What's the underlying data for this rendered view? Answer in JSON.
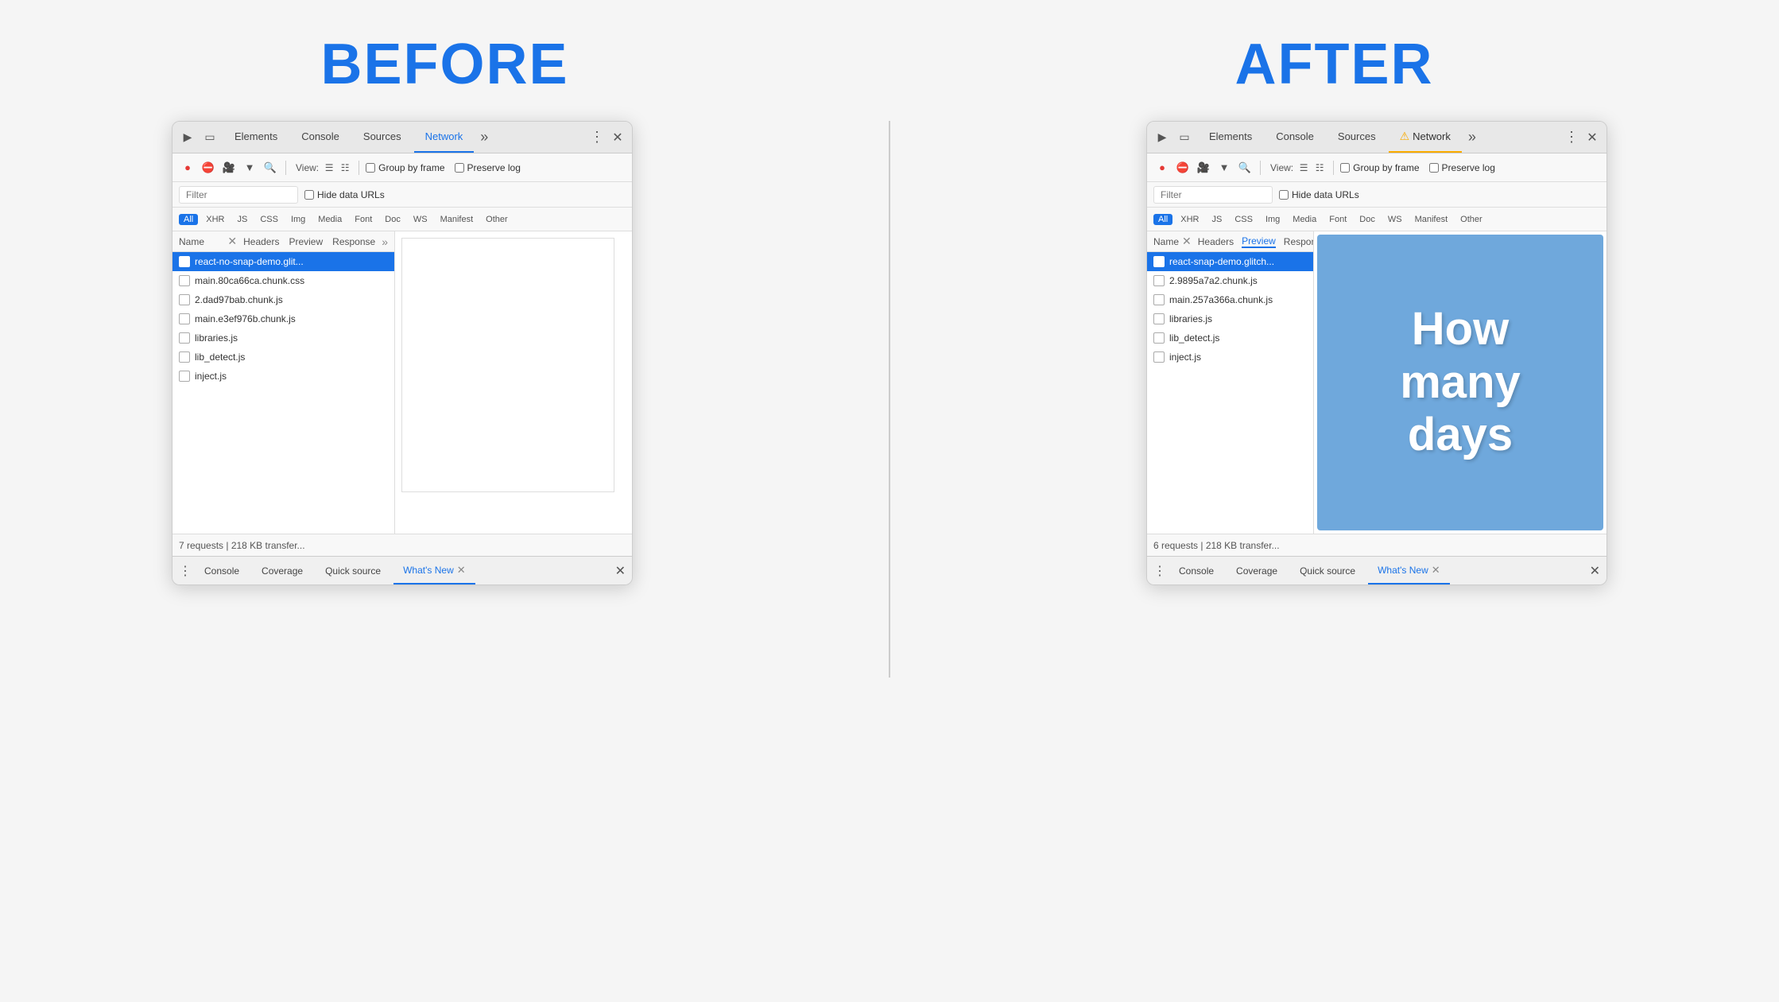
{
  "labels": {
    "before": "BEFORE",
    "after": "AFTER"
  },
  "before": {
    "tabs": [
      "Elements",
      "Console",
      "Sources",
      "Network"
    ],
    "active_tab": "Network",
    "toolbar": {
      "view_label": "View:",
      "group_by_frame": "Group by frame",
      "preserve_log": "Preserve log"
    },
    "filter": {
      "placeholder": "Filter",
      "hide_data_urls": "Hide data URLs"
    },
    "filter_types": [
      "All",
      "XHR",
      "JS",
      "CSS",
      "Img",
      "Media",
      "Font",
      "Doc",
      "WS",
      "Manifest",
      "Other"
    ],
    "active_filter": "All",
    "columns": [
      "Name"
    ],
    "detail_tabs": [
      "Headers",
      "Preview",
      "Response"
    ],
    "active_detail_tab": "Preview",
    "files": [
      {
        "name": "react-no-snap-demo.glit...",
        "selected": true
      },
      {
        "name": "main.80ca66ca.chunk.css",
        "selected": false
      },
      {
        "name": "2.dad97bab.chunk.js",
        "selected": false
      },
      {
        "name": "main.e3ef976b.chunk.js",
        "selected": false
      },
      {
        "name": "libraries.js",
        "selected": false
      },
      {
        "name": "lib_detect.js",
        "selected": false
      },
      {
        "name": "inject.js",
        "selected": false
      }
    ],
    "status": "7 requests | 218 KB transfer...",
    "drawer_tabs": [
      "Console",
      "Coverage",
      "Quick source",
      "What's New"
    ],
    "active_drawer_tab": "What's New",
    "preview_empty": true
  },
  "after": {
    "tabs": [
      "Elements",
      "Console",
      "Sources",
      "Network"
    ],
    "active_tab": "Network",
    "active_tab_warning": true,
    "toolbar": {
      "view_label": "View:",
      "group_by_frame": "Group by frame",
      "preserve_log": "Preserve log"
    },
    "filter": {
      "placeholder": "Filter",
      "hide_data_urls": "Hide data URLs"
    },
    "filter_types": [
      "All",
      "XHR",
      "JS",
      "CSS",
      "Img",
      "Media",
      "Font",
      "Doc",
      "WS",
      "Manifest",
      "Other"
    ],
    "active_filter": "All",
    "columns": [
      "Name"
    ],
    "detail_tabs": [
      "Headers",
      "Preview",
      "Response"
    ],
    "active_detail_tab": "Preview",
    "files": [
      {
        "name": "react-snap-demo.glitch...",
        "selected": true
      },
      {
        "name": "2.9895a7a2.chunk.js",
        "selected": false
      },
      {
        "name": "main.257a366a.chunk.js",
        "selected": false
      },
      {
        "name": "libraries.js",
        "selected": false
      },
      {
        "name": "lib_detect.js",
        "selected": false
      },
      {
        "name": "inject.js",
        "selected": false
      }
    ],
    "status": "6 requests | 218 KB transfer...",
    "drawer_tabs": [
      "Console",
      "Coverage",
      "Quick source",
      "What's New"
    ],
    "active_drawer_tab": "What's New",
    "preview_text": "How\nmany\ndays"
  }
}
